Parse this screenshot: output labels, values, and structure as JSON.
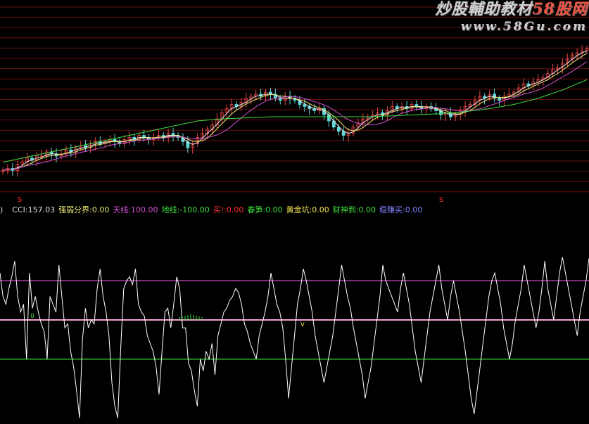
{
  "watermark": {
    "title_part1": "炒股輔助教材",
    "title_part2": "58股网",
    "url": "www.58Gu.com"
  },
  "legend": {
    "prefix": ")",
    "items": [
      {
        "label": "CCI:",
        "value": "157.03",
        "color": "#e0e0e0"
      },
      {
        "label": "强弱分界:",
        "value": "0.00",
        "color": "#e8e870"
      },
      {
        "label": "天线:",
        "value": "100.00",
        "color": "#d050d0"
      },
      {
        "label": "地线:",
        "value": "-100.00",
        "color": "#40e040"
      },
      {
        "label": "买!:",
        "value": "0.00",
        "color": "#ff3030"
      },
      {
        "label": "春笋:",
        "value": "0.00",
        "color": "#40e040"
      },
      {
        "label": "黄金坑:",
        "value": "0.00",
        "color": "#f0e050"
      },
      {
        "label": "财神到:",
        "value": "0.00",
        "color": "#40e040"
      },
      {
        "label": "稳赚买:",
        "value": "0.00",
        "color": "#8080ff"
      }
    ]
  },
  "colors": {
    "background": "#000000",
    "grid": "#6a0f0f",
    "candle_up": "#e04545",
    "candle_down": "#5fd8d8",
    "ma_fast": "#e8e8e8",
    "ma_mid": "#e8e870",
    "ma_slow": "#d050d0",
    "ma_long": "#40e040",
    "cci": "#ffffff",
    "upper_line": "#d050d0",
    "mid_line": "#f0a0d0",
    "lower_line": "#40e040"
  },
  "chart_data": [
    {
      "type": "candlestick",
      "title": "",
      "series": [
        {
          "name": "price",
          "values": [
            96,
            97,
            96,
            99,
            100,
            102,
            101,
            103,
            103,
            105,
            104,
            103,
            104,
            106,
            105,
            107,
            108,
            107,
            109,
            110,
            109,
            110,
            111,
            110,
            109,
            111,
            112,
            111,
            113,
            112,
            111,
            112,
            113,
            112,
            114,
            113,
            112,
            110,
            107,
            109,
            112,
            114,
            116,
            118,
            121,
            124,
            126,
            128,
            127,
            129,
            131,
            132,
            133,
            132,
            134,
            133,
            131,
            130,
            132,
            131,
            130,
            128,
            127,
            126,
            125,
            126,
            123,
            120,
            117,
            115,
            113,
            114,
            117,
            119,
            121,
            122,
            123,
            124,
            123,
            125,
            127,
            126,
            127,
            126,
            128,
            127,
            126,
            127,
            126,
            125,
            123,
            124,
            122,
            123,
            125,
            127,
            128,
            130,
            132,
            131,
            133,
            131,
            130,
            132,
            133,
            134,
            136,
            138,
            137,
            139,
            140,
            141,
            143,
            145,
            146,
            148,
            150,
            152,
            153,
            154,
            155
          ]
        },
        {
          "name": "ma_long",
          "values": [
            100,
            100.5,
            101,
            101.5,
            102,
            102.5,
            103,
            103.5,
            104,
            104.5,
            105,
            105.5,
            106,
            106.5,
            107,
            107.5,
            108,
            108.5,
            109,
            109.5,
            110,
            110.5,
            111,
            111.5,
            112,
            112.5,
            113,
            113.5,
            114,
            114.5,
            115,
            115.5,
            116,
            116.5,
            117,
            117.5,
            118,
            118.5,
            119,
            119.5,
            120,
            120.2,
            120.4,
            120.6,
            120.8,
            121,
            121.1,
            121.2,
            121.3,
            121.4,
            121.5,
            121.6,
            121.7,
            121.8,
            121.9,
            122,
            122,
            122,
            122,
            122,
            122,
            122,
            122,
            122,
            122,
            122,
            122,
            122,
            122,
            122,
            122,
            122,
            122,
            122,
            122,
            122,
            122.1,
            122.2,
            122.3,
            122.4,
            122.5,
            122.6,
            122.7,
            122.8,
            122.9,
            123,
            123.1,
            123.2,
            123.3,
            123.4,
            123.5,
            123.7,
            123.9,
            124.1,
            124.3,
            124.5,
            124.8,
            125.1,
            125.4,
            125.7,
            126,
            126.4,
            126.8,
            127.2,
            127.6,
            128,
            128.6,
            129.2,
            129.8,
            130.4,
            131,
            131.8,
            132.6,
            133.4,
            134.2,
            135,
            136,
            137,
            138,
            139,
            140
          ]
        }
      ],
      "ylim": [
        90,
        165
      ]
    },
    {
      "type": "line",
      "title": "CCI",
      "series": [
        {
          "name": "CCI",
          "values": [
            120,
            60,
            40,
            80,
            110,
            150,
            60,
            20,
            40,
            -100,
            120,
            30,
            60,
            20,
            -10,
            -30,
            -100,
            60,
            40,
            20,
            140,
            60,
            -20,
            -10,
            -80,
            -120,
            -180,
            -250,
            -50,
            30,
            -20,
            0,
            -10,
            80,
            130,
            60,
            20,
            -40,
            -160,
            -220,
            -250,
            -70,
            80,
            100,
            110,
            90,
            130,
            40,
            20,
            10,
            -40,
            -60,
            -80,
            -120,
            -190,
            -80,
            20,
            30,
            -20,
            40,
            110,
            80,
            -20,
            -20,
            -110,
            -130,
            -180,
            -220,
            -100,
            -130,
            -80,
            -100,
            -60,
            -140,
            -40,
            -10,
            20,
            30,
            50,
            60,
            80,
            70,
            40,
            -10,
            -30,
            -60,
            -80,
            -100,
            -40,
            -10,
            20,
            60,
            120,
            80,
            40,
            20,
            -20,
            -100,
            -200,
            -120,
            -40,
            40,
            80,
            130,
            100,
            60,
            20,
            -40,
            -80,
            -120,
            -160,
            -120,
            -80,
            -40,
            20,
            80,
            140,
            100,
            60,
            30,
            -20,
            -60,
            -100,
            -140,
            -200,
            -160,
            -120,
            -60,
            0,
            60,
            140,
            100,
            80,
            60,
            40,
            20,
            80,
            120,
            80,
            40,
            -20,
            -80,
            -120,
            -160,
            -100,
            -40,
            20,
            60,
            100,
            140,
            80,
            40,
            0,
            60,
            100,
            60,
            20,
            -30,
            -80,
            -140,
            -200,
            -240,
            -180,
            -120,
            -60,
            0,
            60,
            100,
            120,
            80,
            40,
            -20,
            -60,
            -100,
            -60,
            0,
            40,
            80,
            140,
            100,
            60,
            20,
            -20,
            20,
            80,
            150,
            80,
            40,
            0,
            60,
            120,
            160,
            120,
            80,
            40,
            0,
            -40,
            20,
            60,
            100,
            157
          ]
        }
      ],
      "reference_lines": [
        100,
        0,
        -100
      ],
      "ylim": [
        -260,
        260
      ]
    }
  ]
}
